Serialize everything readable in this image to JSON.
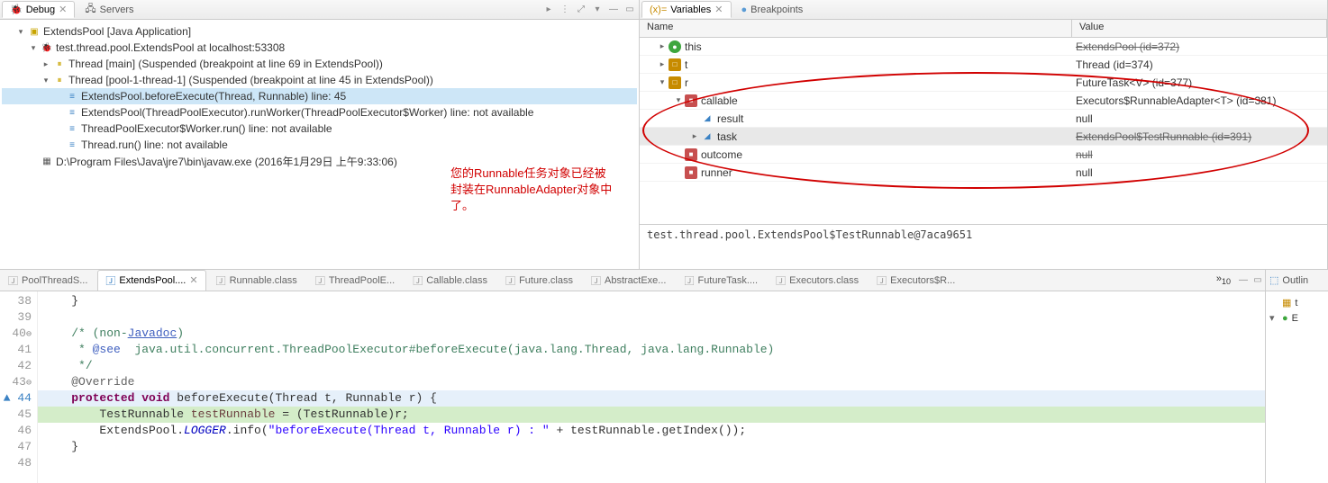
{
  "debug": {
    "tab_debug": "Debug",
    "tab_servers": "Servers",
    "root": "ExtendsPool [Java Application]",
    "process": "test.thread.pool.ExtendsPool at localhost:53308",
    "thread_main": "Thread [main] (Suspended (breakpoint at line 69 in ExtendsPool))",
    "thread_pool": "Thread [pool-1-thread-1] (Suspended (breakpoint at line 45 in ExtendsPool))",
    "frame1": "ExtendsPool.beforeExecute(Thread, Runnable) line: 45",
    "frame2": "ExtendsPool(ThreadPoolExecutor).runWorker(ThreadPoolExecutor$Worker) line: not available",
    "frame3": "ThreadPoolExecutor$Worker.run() line: not available",
    "frame4": "Thread.run() line: not available",
    "javaw": "D:\\Program Files\\Java\\jre7\\bin\\javaw.exe (2016年1月29日 上午9:33:06)"
  },
  "annotation": {
    "line1": "您的Runnable任务对象已经被",
    "line2": "封装在RunnableAdapter对象中",
    "line3": "了。"
  },
  "vars": {
    "tab_variables": "Variables",
    "tab_breakpoints": "Breakpoints",
    "col_name": "Name",
    "col_value": "Value",
    "rows": [
      {
        "tw": "▸",
        "ic": "this",
        "ind": 1,
        "name": "this",
        "value": "ExtendsPool  (id=372)",
        "struck": true
      },
      {
        "tw": "▸",
        "ic": "arg",
        "ind": 1,
        "name": "t",
        "value": "Thread  (id=374)"
      },
      {
        "tw": "▾",
        "ic": "arg",
        "ind": 1,
        "name": "r",
        "value": "FutureTask<V>  (id=377)"
      },
      {
        "tw": "▾",
        "ic": "field",
        "ind": 2,
        "name": "callable",
        "value": "Executors$RunnableAdapter<T>  (id=381)"
      },
      {
        "tw": "",
        "ic": "blue",
        "ind": 3,
        "name": "result",
        "value": "null"
      },
      {
        "tw": "▸",
        "ic": "blue",
        "ind": 3,
        "name": "task",
        "value": "ExtendsPool$TestRunnable  (id=391)",
        "sel": true,
        "struck": true
      },
      {
        "tw": "",
        "ic": "field",
        "ind": 2,
        "name": "outcome",
        "value": "null",
        "struck": true
      },
      {
        "tw": "",
        "ic": "field",
        "ind": 2,
        "name": "runner",
        "value": "null"
      }
    ],
    "detail": "test.thread.pool.ExtendsPool$TestRunnable@7aca9651"
  },
  "editor": {
    "tabs": [
      "PoolThreadS...",
      "ExtendsPool....",
      "Runnable.class",
      "ThreadPoolE...",
      "Callable.class",
      "Future.class",
      "AbstractExe...",
      "FutureTask....",
      "Executors.class",
      "Executors$R..."
    ],
    "active_tab": 1,
    "more": "»",
    "more_count": "10",
    "lines": {
      "38": "    }",
      "39": "",
      "40": "    /* (non-Javadoc)",
      "41": "     * @see  java.util.concurrent.ThreadPoolExecutor#beforeExecute(java.lang.Thread, java.lang.Runnable)",
      "42": "     */",
      "43": "    @Override",
      "44": "    protected void beforeExecute(Thread t, Runnable r) {",
      "45": "        TestRunnable testRunnable = (TestRunnable)r;",
      "46": "        ExtendsPool.LOGGER.info(\"beforeExecute(Thread t, Runnable r) : \" + testRunnable.getIndex());",
      "47": "    }",
      "48": ""
    }
  },
  "outline": {
    "tab": "Outlin",
    "item1": "t",
    "item2": "E"
  }
}
